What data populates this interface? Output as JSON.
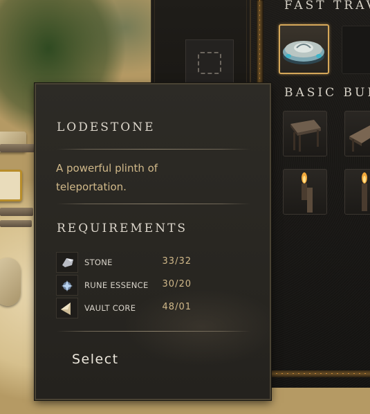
{
  "tooltip": {
    "title": "LODESTONE",
    "description": "A powerful plinth of teleportation.",
    "requirements_title": "REQUIREMENTS",
    "requirements": [
      {
        "name": "STONE",
        "count": "33/32",
        "icon": "stone-icon"
      },
      {
        "name": "RUNE ESSENCE",
        "count": "30/20",
        "icon": "rune-essence-icon"
      },
      {
        "name": "VAULT CORE",
        "count": "48/01",
        "icon": "vault-core-icon"
      }
    ],
    "action_label": "Select"
  },
  "build_menu": {
    "sections": [
      {
        "title": "FAST TRAV",
        "items": [
          {
            "icon": "lodestone-icon",
            "selected": true
          },
          {
            "icon": "empty-slot",
            "selected": false
          }
        ]
      },
      {
        "title": "BASIC BUI",
        "items": [
          {
            "icon": "table-icon"
          },
          {
            "icon": "table-icon-2"
          },
          {
            "icon": "wall-torch-icon"
          },
          {
            "icon": "wall-torch-icon-2"
          }
        ]
      }
    ]
  },
  "colors": {
    "accent_gold": "#d6a85a",
    "description_text": "#d1b98a",
    "count_text": "#d1b98a"
  }
}
